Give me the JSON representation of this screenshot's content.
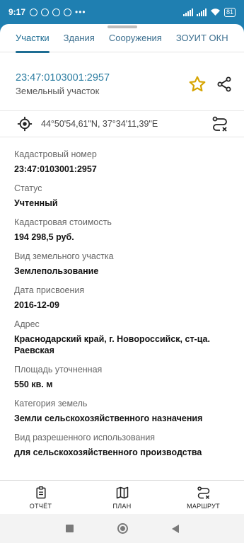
{
  "status_bar": {
    "time": "9:17",
    "battery": "81",
    "extra": "•••"
  },
  "tabs": [
    {
      "label": "Участки",
      "active": true
    },
    {
      "label": "Здания",
      "active": false
    },
    {
      "label": "Сооружения",
      "active": false
    },
    {
      "label": "ЗОУИТ ОКН",
      "active": false
    }
  ],
  "header": {
    "title": "23:47:0103001:2957",
    "subtitle": "Земельный участок"
  },
  "coords": "44°50'54,61\"N, 37°34'11,39\"E",
  "fields": [
    {
      "label": "Кадастровый номер",
      "value": "23:47:0103001:2957"
    },
    {
      "label": "Статус",
      "value": "Учтенный"
    },
    {
      "label": "Кадастровая стоимость",
      "value": "194 298,5 руб."
    },
    {
      "label": "Вид земельного участка",
      "value": "Землепользование"
    },
    {
      "label": "Дата присвоения",
      "value": "2016-12-09"
    },
    {
      "label": "Адрес",
      "value": "Краснодарский край, г. Новороссийск, ст-ца. Раевская"
    },
    {
      "label": "Площадь уточненная",
      "value": "550 кв. м"
    },
    {
      "label": "Категория земель",
      "value": "Земли сельскохозяйственного назначения"
    },
    {
      "label": "Вид разрешенного использования",
      "value": "для сельскохозяйственного производства"
    }
  ],
  "bottom_nav": {
    "report": "ОТЧЁТ",
    "plan": "ПЛАН",
    "route": "МАРШРУТ"
  },
  "colors": {
    "accent": "#1e6d93",
    "status_bar": "#1f7fb1",
    "star": "#d6a400"
  },
  "icons": [
    "star-icon",
    "share-icon",
    "target-icon",
    "route-icon",
    "report-icon",
    "map-icon"
  ]
}
